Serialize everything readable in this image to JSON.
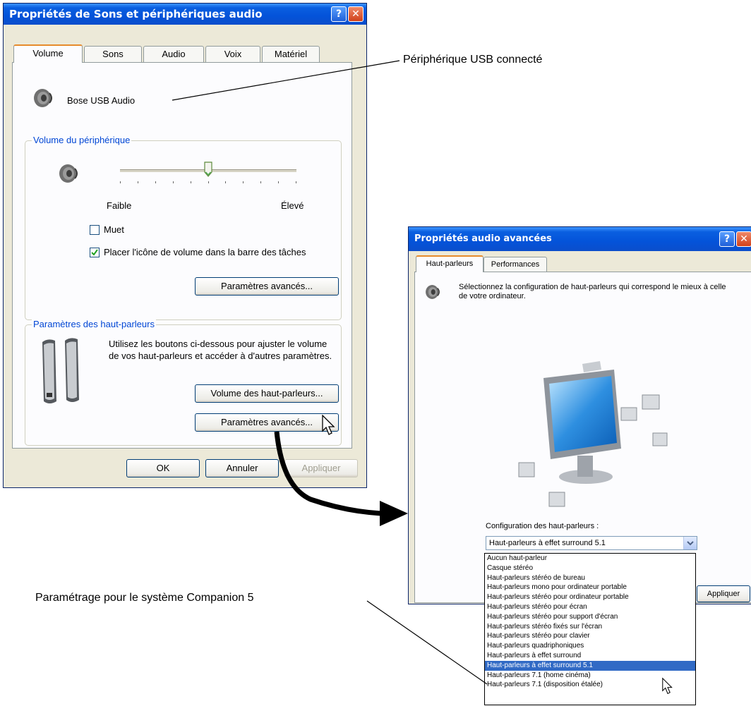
{
  "main_window": {
    "title": "Propriétés de Sons et périphériques audio",
    "help_glyph": "?",
    "close_glyph": "✕",
    "tabs": [
      {
        "label": "Volume",
        "active": true
      },
      {
        "label": "Sons",
        "active": false
      },
      {
        "label": "Audio",
        "active": false
      },
      {
        "label": "Voix",
        "active": false
      },
      {
        "label": "Matériel",
        "active": false
      }
    ],
    "device_name": "Bose USB Audio",
    "device_volume": {
      "group_title": "Volume du périphérique",
      "slider_value": 0.5,
      "low_label": "Faible",
      "high_label": "Élevé",
      "mute_label": "Muet",
      "mute_checked": false,
      "tray_label": "Placer l'icône de volume dans la barre des tâches",
      "tray_checked": true,
      "advanced_button": "Paramètres avancés..."
    },
    "speakers": {
      "group_title": "Paramètres des haut-parleurs",
      "description": "Utilisez les boutons ci-dessous pour ajuster le volume de vos haut-parleurs et accéder à d'autres paramètres.",
      "volume_button": "Volume des haut-parleurs...",
      "advanced_button": "Paramètres avancés..."
    },
    "footer": {
      "ok": "OK",
      "cancel": "Annuler",
      "apply": "Appliquer"
    }
  },
  "advanced_window": {
    "title": "Propriétés audio avancées",
    "help_glyph": "?",
    "close_glyph": "✕",
    "tabs": [
      {
        "label": "Haut-parleurs",
        "active": true
      },
      {
        "label": "Performances",
        "active": false
      }
    ],
    "instruction": "Sélectionnez la configuration de haut-parleurs qui correspond le mieux à celle de votre ordinateur.",
    "config_label": "Configuration des haut-parleurs :",
    "selected_value": "Haut-parleurs à effet surround 5.1",
    "options": [
      "Aucun haut-parleur",
      "Casque stéréo",
      "Haut-parleurs stéréo de bureau",
      "Haut-parleurs mono pour ordinateur portable",
      "Haut-parleurs stéréo pour ordinateur portable",
      "Haut-parleurs stéréo pour écran",
      "Haut-parleurs stéréo pour support d'écran",
      "Haut-parleurs stéréo fixés sur l'écran",
      "Haut-parleurs stéréo pour clavier",
      "Haut-parleurs quadriphoniques",
      "Haut-parleurs à effet surround",
      "Haut-parleurs à effet surround 5.1",
      "Haut-parleurs 7.1 (home cinéma)",
      "Haut-parleurs 7.1 (disposition étalée)"
    ],
    "highlighted_index": 11,
    "apply_button": "Appliquer"
  },
  "annotations": {
    "usb_connected": "Périphérique USB connecté",
    "companion_setting": "Paramétrage pour le système Companion 5"
  },
  "colors": {
    "xp_title_blue": "#0453d9",
    "group_title_blue": "#0046d5",
    "selection_blue": "#316ac5",
    "active_tab_orange": "#e68b2c"
  }
}
